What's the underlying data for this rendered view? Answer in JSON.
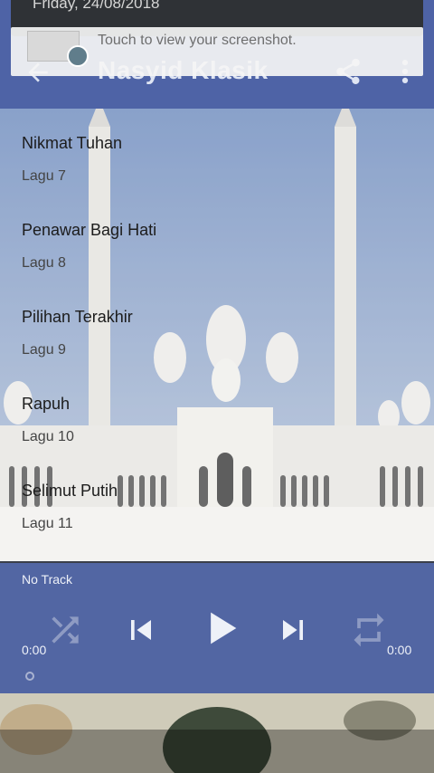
{
  "notification": {
    "date": "Friday, 24/08/2018",
    "message": "Touch to view your screenshot."
  },
  "appbar": {
    "title": "Nasyid Klasik",
    "back_icon": "arrow-back-icon",
    "share_icon": "share-icon",
    "more_icon": "more-vert-icon"
  },
  "songs": [
    {
      "title": "Nikmat Tuhan",
      "subtitle": "Lagu 7"
    },
    {
      "title": "Penawar Bagi Hati",
      "subtitle": "Lagu 8"
    },
    {
      "title": "Pilihan Terakhir",
      "subtitle": "Lagu 9"
    },
    {
      "title": "Rapuh",
      "subtitle": "Lagu 10"
    },
    {
      "title": "Selimut Putih",
      "subtitle": "Lagu 11"
    }
  ],
  "player": {
    "track": "No Track",
    "elapsed": "0:00",
    "duration": "0:00",
    "progress": 0,
    "controls": [
      "shuffle-icon",
      "skip-previous-icon",
      "play-icon",
      "skip-next-icon",
      "repeat-icon"
    ]
  },
  "colors": {
    "appbar": "#4e63a6",
    "player": "#556caf"
  }
}
